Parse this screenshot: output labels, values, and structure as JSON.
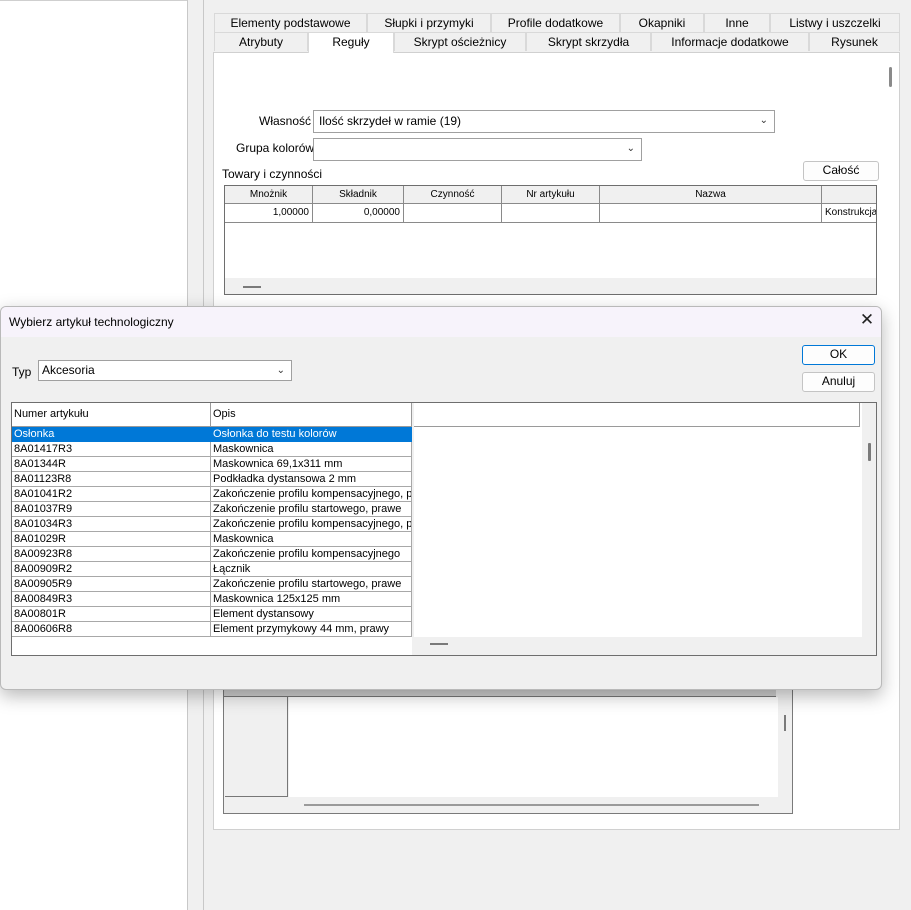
{
  "tabs_row1": [
    "Elementy podstawowe",
    "Słupki i przymyki",
    "Profile dodatkowe",
    "Okapniki",
    "Inne",
    "Listwy i uszczelki"
  ],
  "tabs_row2": [
    "Atrybuty",
    "Reguły",
    "Skrypt ościeżnicy",
    "Skrypt skrzydła",
    "Informacje dodatkowe",
    "Rysunek"
  ],
  "active_tab": "Reguły",
  "rules": {
    "property_label": "Własność",
    "property_value": "Ilość skrzydeł w ramie (19)",
    "color_group_label": "Grupa kolorów",
    "color_group_value": "",
    "goods_label": "Towary i czynności",
    "all_button": "Całość",
    "grid_headers": [
      "Mnożnik",
      "Składnik",
      "Czynność",
      "Nr artykułu",
      "Nazwa",
      ""
    ],
    "grid_row": [
      "1,00000",
      "0,00000",
      "",
      "",
      "",
      "Konstrukcja"
    ]
  },
  "dialog": {
    "title": "Wybierz artykuł technologiczny",
    "type_label": "Typ",
    "type_value": "Akcesoria",
    "ok_button": "OK",
    "cancel_button": "Anuluj",
    "columns": [
      "Numer artykułu",
      "Opis"
    ],
    "rows": [
      {
        "num": "Osłonka",
        "desc": "Osłonka do testu kolorów"
      },
      {
        "num": "8A01417R3",
        "desc": "Maskownica"
      },
      {
        "num": "8A01344R",
        "desc": "Maskownica 69,1x311 mm"
      },
      {
        "num": "8A01123R8",
        "desc": "Podkładka dystansowa 2 mm"
      },
      {
        "num": "8A01041R2",
        "desc": "Zakończenie profilu kompensacyjnego, p"
      },
      {
        "num": "8A01037R9",
        "desc": "Zakończenie profilu startowego, prawe"
      },
      {
        "num": "8A01034R3",
        "desc": "Zakończenie profilu kompensacyjnego, p"
      },
      {
        "num": "8A01029R",
        "desc": "Maskownica"
      },
      {
        "num": "8A00923R8",
        "desc": "Zakończenie profilu kompensacyjnego"
      },
      {
        "num": "8A00909R2",
        "desc": "Łącznik"
      },
      {
        "num": "8A00905R9",
        "desc": "Zakończenie profilu startowego, prawe"
      },
      {
        "num": "8A00849R3",
        "desc": "Maskownica 125x125 mm"
      },
      {
        "num": "8A00801R",
        "desc": "Element dystansowy"
      },
      {
        "num": "8A00606R8",
        "desc": "Element przymykowy 44 mm, prawy"
      }
    ],
    "selected_row": 0
  },
  "colors": {
    "selection": "#0078d7",
    "window_bg": "#f0f0f0"
  }
}
